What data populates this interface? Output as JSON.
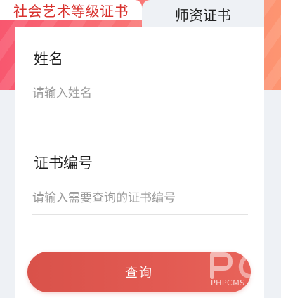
{
  "tabs": [
    {
      "label": "社会艺术等级证书",
      "active": true
    },
    {
      "label": "师资证书",
      "active": false
    }
  ],
  "form": {
    "name": {
      "label": "姓名",
      "placeholder": "请输入姓名",
      "value": ""
    },
    "cert_no": {
      "label": "证书编号",
      "placeholder": "请输入需要查询的证书编号",
      "value": ""
    }
  },
  "query_button": {
    "label": "查询"
  },
  "watermark": {
    "text": "PHPCMS"
  },
  "colors": {
    "accent": "#d8322e",
    "button": "#e05a52",
    "hero_start": "#f8576f",
    "hero_end": "#fd9571"
  }
}
